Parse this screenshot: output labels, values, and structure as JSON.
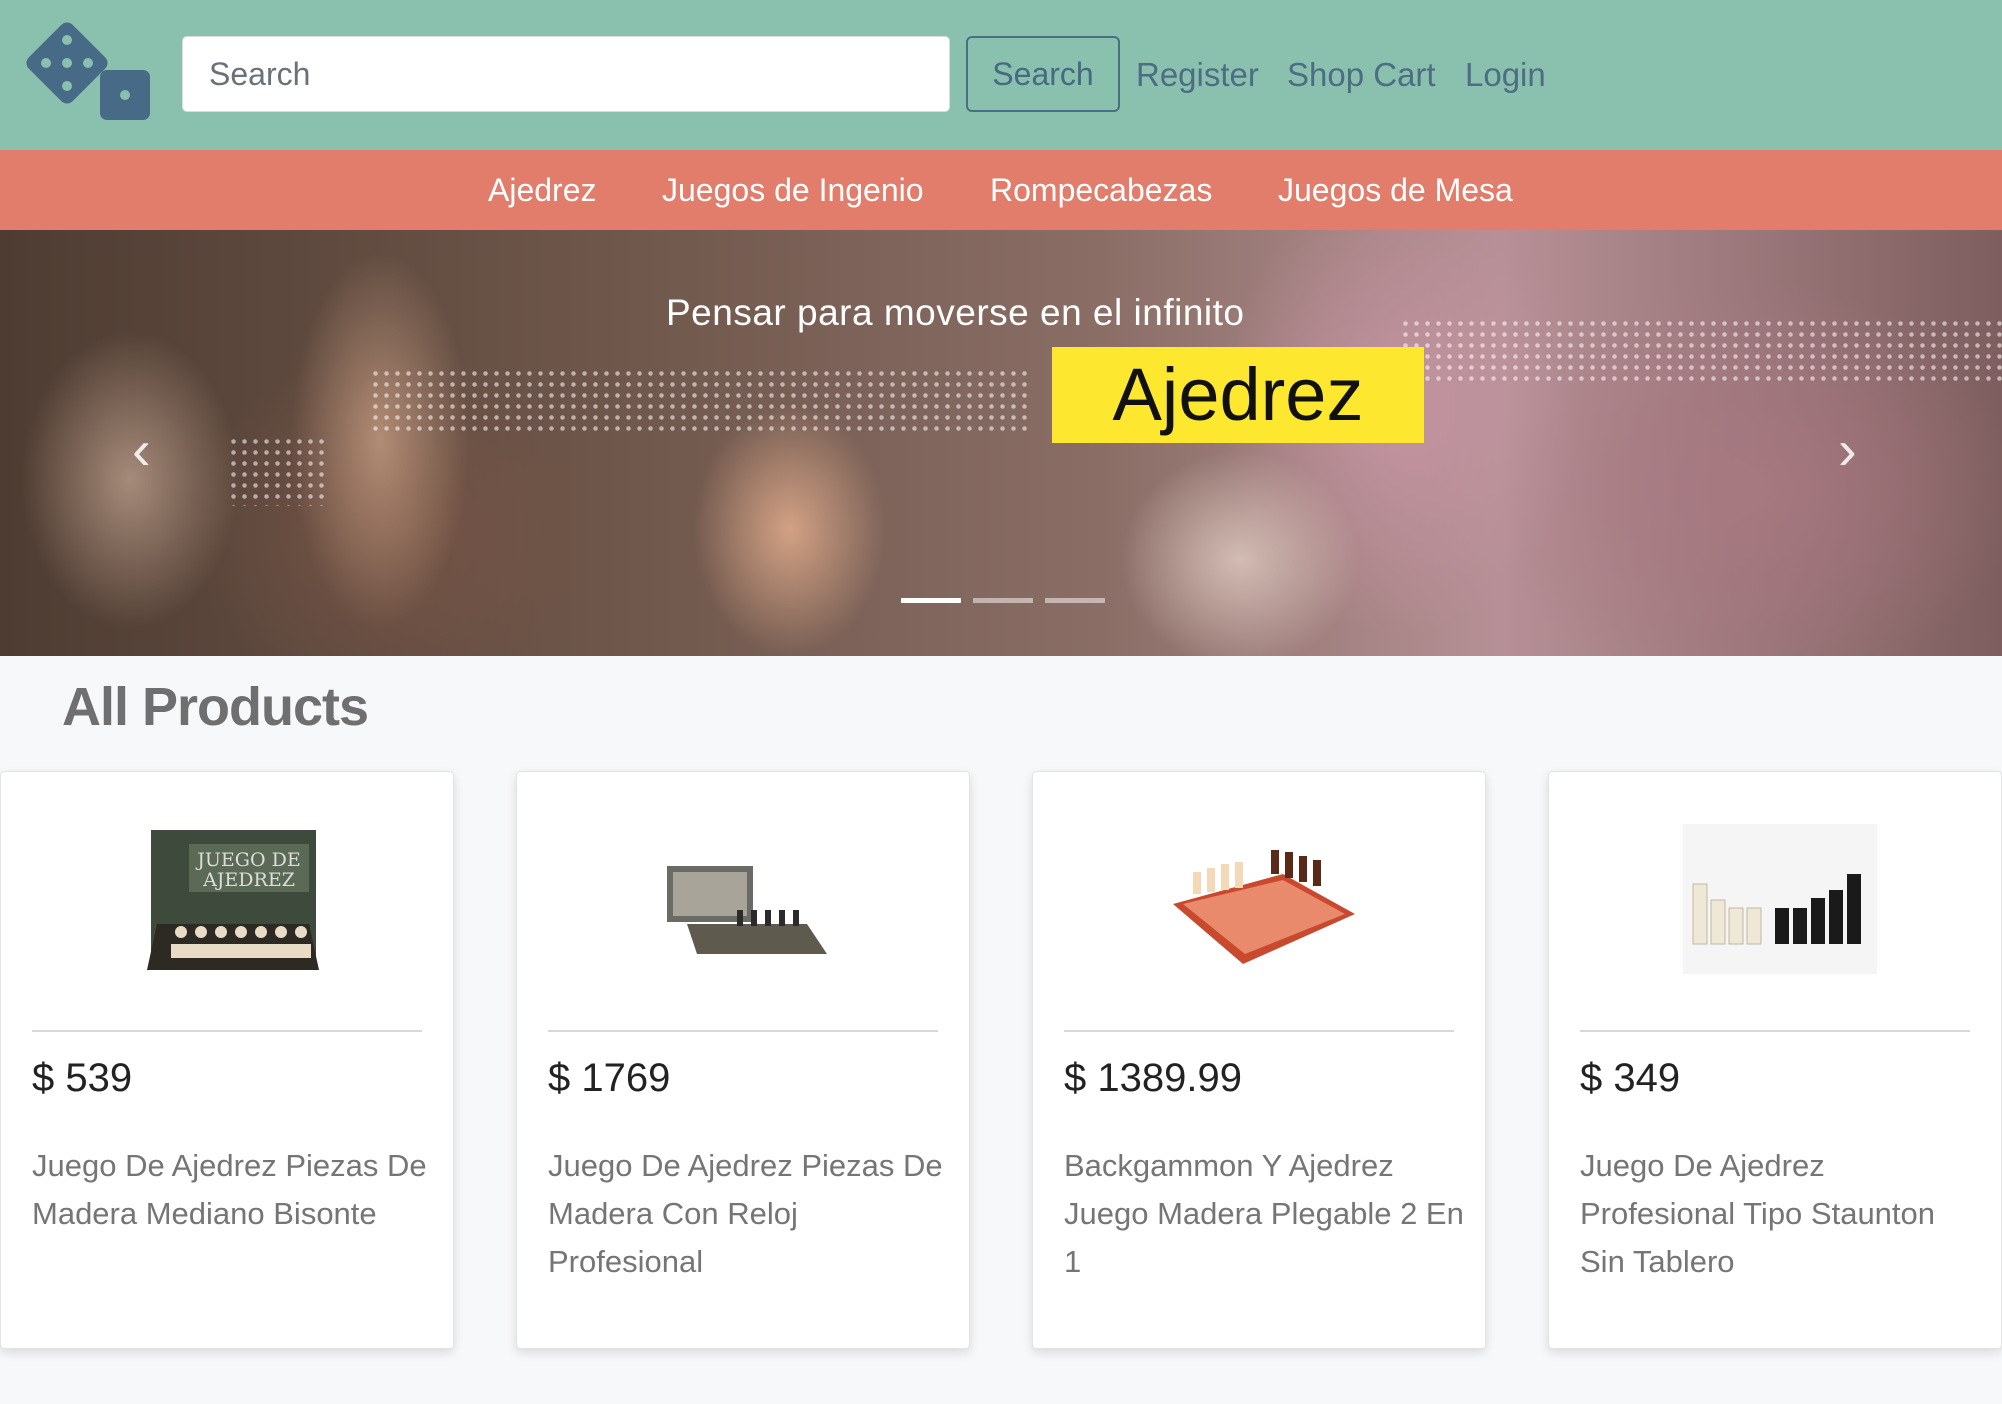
{
  "header": {
    "search_placeholder": "Search",
    "search_button": "Search",
    "links": {
      "register": "Register",
      "shop_cart": "Shop Cart",
      "login": "Login"
    }
  },
  "categories": [
    "Ajedrez",
    "Juegos de Ingenio",
    "Rompecabezas",
    "Juegos de Mesa"
  ],
  "hero": {
    "tagline": "Pensar para moverse en el infinito",
    "highlight": "Ajedrez",
    "slide_count": 3,
    "active_slide": 1
  },
  "section_title": "All Products",
  "products": [
    {
      "price": "$ 539",
      "title": "Juego De Ajedrez Piezas De Madera Mediano Bisonte"
    },
    {
      "price": "$ 1769",
      "title": "Juego De Ajedrez Piezas De Madera Con Reloj Profesional"
    },
    {
      "price": "$ 1389.99",
      "title": "Backgammon Y Ajedrez Juego Madera Plegable 2 En 1"
    },
    {
      "price": "$ 349",
      "title": "Juego De Ajedrez Profesional Tipo Staunton Sin Tablero"
    }
  ],
  "colors": {
    "header_bg": "#8ac0ae",
    "category_bar_bg": "#e27c6b",
    "highlight_bg": "#fde82f",
    "link_color": "#4d6d82"
  },
  "icons": {
    "logo": "dice-icon",
    "prev": "chevron-left-icon",
    "next": "chevron-right-icon"
  }
}
